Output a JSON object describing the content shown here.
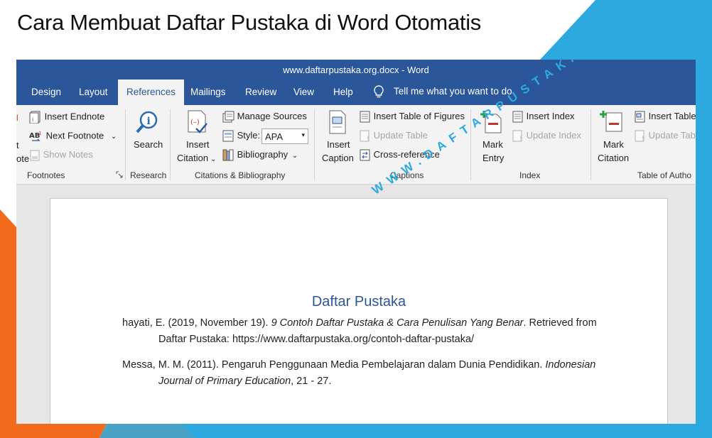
{
  "headline": "Cara Membuat Daftar Pustaka di Word Otomatis",
  "watermark": "WWW.DAFTARPUSTAKA.ORG",
  "window": {
    "title": "www.daftarpustaka.org.docx  -  Word"
  },
  "tabs": [
    "Design",
    "Layout",
    "References",
    "Mailings",
    "Review",
    "View",
    "Help"
  ],
  "active_tab": "References",
  "tell_me": "Tell me what you want to do",
  "ribbon": {
    "footnotes": {
      "insert_endnote": "Insert Endnote",
      "next_footnote": "Next Footnote",
      "show_notes": "Show Notes",
      "partial_t": "t",
      "partial_ote": "ote",
      "partial_l": "l",
      "group": "Footnotes"
    },
    "research": {
      "search": "Search",
      "group": "Research"
    },
    "citations": {
      "insert_citation_1": "Insert",
      "insert_citation_2": "Citation",
      "manage_sources": "Manage Sources",
      "style_label": "Style:",
      "style_value": "APA",
      "bibliography": "Bibliography",
      "group": "Citations & Bibliography"
    },
    "captions": {
      "insert_caption_1": "Insert",
      "insert_caption_2": "Caption",
      "insert_table_of_figures": "Insert Table of Figures",
      "update_table": "Update Table",
      "cross_reference": "Cross-reference",
      "group": "Captions"
    },
    "index": {
      "mark_entry_1": "Mark",
      "mark_entry_2": "Entry",
      "insert_index": "Insert Index",
      "update_index": "Update Index",
      "group": "Index"
    },
    "authorities": {
      "mark_citation_1": "Mark",
      "mark_citation_2": "Citation",
      "insert_table": "Insert Table",
      "update_table": "Update Table",
      "group": "Table of Autho"
    }
  },
  "document": {
    "heading": "Daftar Pustaka",
    "references": [
      {
        "line1_plain": "hayati, E. (2019, November 19). ",
        "line1_italic": "9 Contoh Daftar Pustaka & Cara Penulisan Yang Benar",
        "line1_tail": ". Retrieved from",
        "line2": "Daftar Pustaka: https://www.daftarpustaka.org/contoh-daftar-pustaka/"
      },
      {
        "line1_plain": "Messa, M. M. (2011). Pengaruh Penggunaan Media Pembelajaran dalam Dunia Pendidikan. ",
        "line1_italic": "Indonesian",
        "line2_italic": "Journal of Primary Education",
        "line2_tail": ", 21 - 27."
      }
    ]
  },
  "colors": {
    "word_blue": "#2b579a",
    "heading_blue": "#2e5597",
    "accent_orange": "#f26b1d",
    "accent_cyan": "#2ea9df"
  }
}
